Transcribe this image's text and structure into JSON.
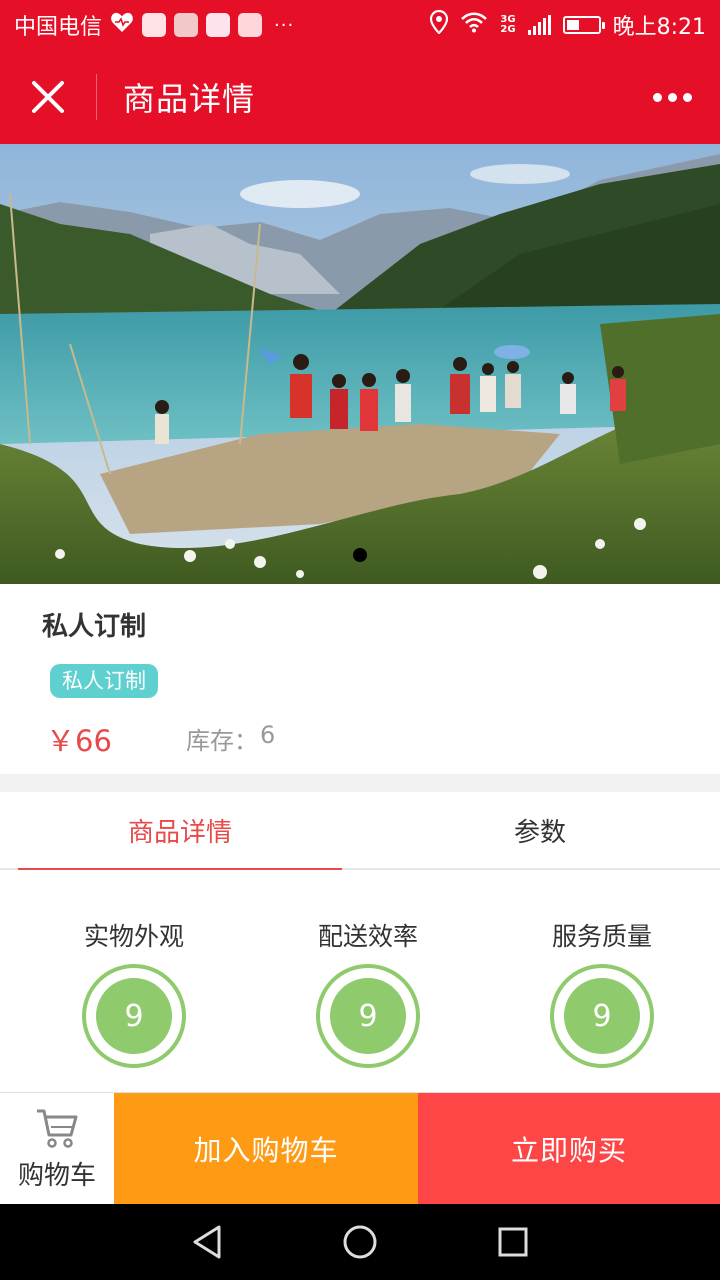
{
  "status_bar": {
    "carrier": "中国电信",
    "overflow": "···",
    "network": "3G",
    "network_sub": "2G",
    "battery_level": 0.4,
    "time": "晚上8:21"
  },
  "header": {
    "title": "商品详情",
    "close_icon": "close-icon",
    "more_icon": "more-dots-icon"
  },
  "banner": {
    "image": "lake-mountain-photo",
    "indicator_count": 1,
    "indicator_active": 0
  },
  "product": {
    "name": "私人订制",
    "tag": "私人订制",
    "price": "￥66",
    "stock_label": "库存：",
    "stock_value": "6"
  },
  "tabs": [
    {
      "label": "商品详情",
      "active": true
    },
    {
      "label": "参数",
      "active": false
    }
  ],
  "ratings": [
    {
      "label": "实物外观",
      "score": "9"
    },
    {
      "label": "配送效率",
      "score": "9"
    },
    {
      "label": "服务质量",
      "score": "9"
    }
  ],
  "action_bar": {
    "cart_label": "购物车",
    "add_to_cart": "加入购物车",
    "buy_now": "立即购买"
  },
  "colors": {
    "brand_red": "#e60f28",
    "price_red": "#e84a4a",
    "tag_teal": "#5fd0d0",
    "rating_green": "#8fca6c",
    "add_cart_orange": "#ff9a14",
    "buy_now_red": "#ff4646"
  },
  "nav_bar": [
    "back-icon",
    "home-icon",
    "recents-icon"
  ]
}
